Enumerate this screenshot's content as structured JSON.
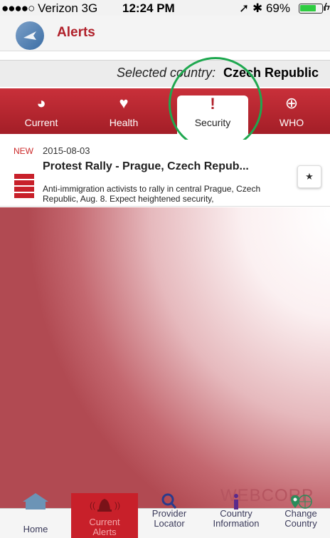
{
  "status_bar": {
    "signal": "●●●●○",
    "carrier": "Verizon",
    "network": "3G",
    "time": "12:24 PM",
    "indicators": "➚ ✱",
    "battery": "69%"
  },
  "header": {
    "title": "Alerts",
    "logo_icon": "airplane-globe-icon"
  },
  "country_bar": {
    "label": "Selected country:",
    "value": "Czech Republic"
  },
  "tabs": [
    {
      "label": "Current",
      "icon": "◕"
    },
    {
      "label": "Health",
      "icon": "♥"
    },
    {
      "label": "Security",
      "icon": "!"
    },
    {
      "label": "WHO",
      "icon": "⊕"
    }
  ],
  "alert": {
    "badge": "NEW",
    "date": "2015-08-03",
    "title": "Protest Rally - Prague, Czech Repub...",
    "body": "Anti-immigration activists to rally in central Prague, Czech Republic, Aug. 8. Expect heightened security,",
    "star": "★"
  },
  "watermark": "WEBCORP",
  "tabbar": {
    "items": [
      {
        "label": "Home",
        "icon": "home-icon"
      },
      {
        "label": "Current Alerts",
        "icon": "alarm-bell-icon"
      },
      {
        "label": "Provider Locator",
        "icon": "magnifier-icon"
      },
      {
        "label": "Country Information",
        "icon": "info-icon"
      },
      {
        "label": "Change Country",
        "icon": "globe-pin-icon"
      }
    ],
    "active_index": 1,
    "labels_split": [
      [
        "Home"
      ],
      [
        "Current",
        "Alerts"
      ],
      [
        "Provider",
        "Locator"
      ],
      [
        "Country",
        "Information"
      ],
      [
        "Change",
        "Country"
      ]
    ]
  },
  "colors": {
    "accent": "#c8202a",
    "highlight": "#1ea84f"
  }
}
